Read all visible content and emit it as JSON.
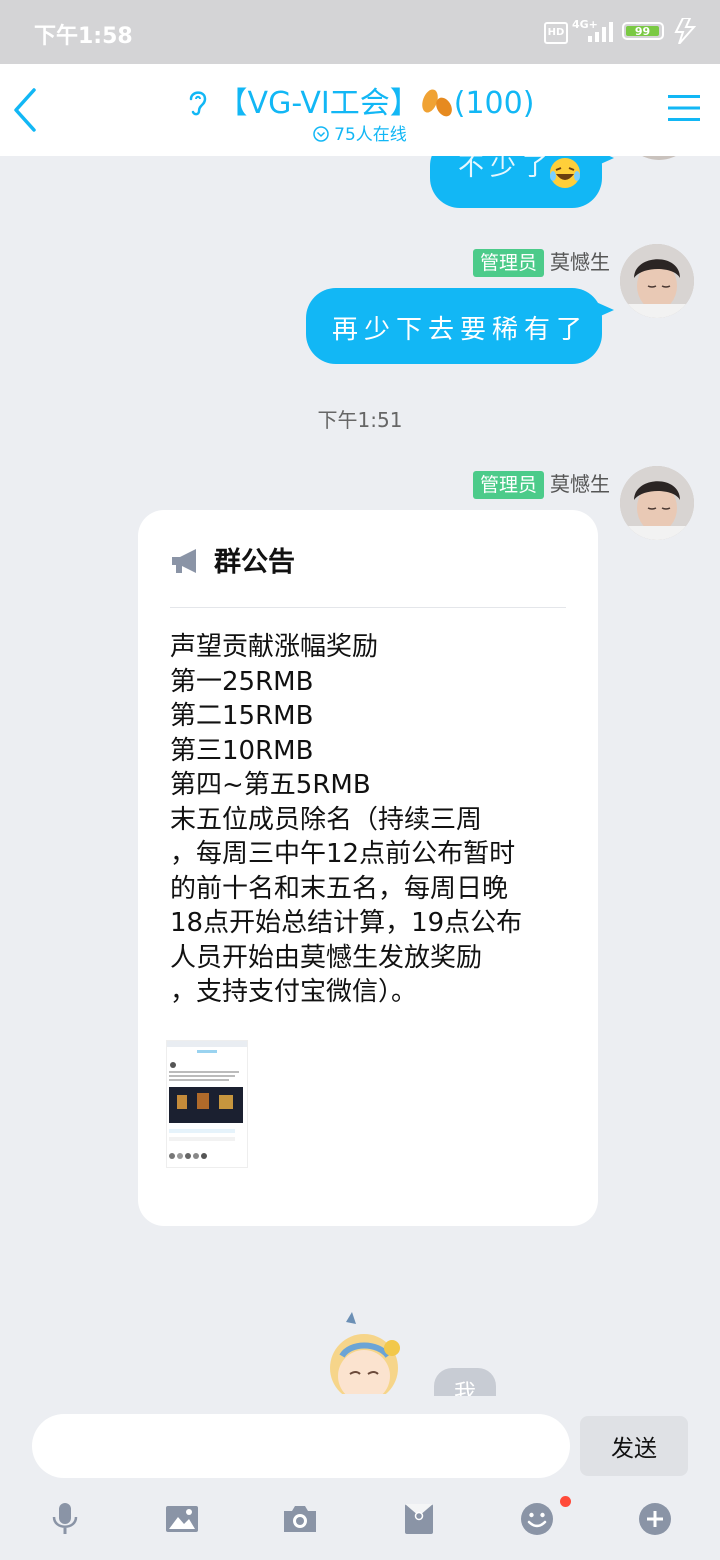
{
  "status_bar": {
    "time": "下午1:58",
    "hd": "HD",
    "network": "4G+",
    "battery": "99"
  },
  "header": {
    "title": "【VG-VI工会】",
    "member_count": "(100)",
    "online": "75人在线",
    "accent_color": "#12b7f5"
  },
  "messages": {
    "partial_top": {
      "text": "不少了"
    },
    "msg2": {
      "role_badge": "管理员",
      "sender": "莫憾生",
      "text": "再少下去要稀有了"
    },
    "timestamp": "下午1:51",
    "msg3": {
      "role_badge": "管理员",
      "sender": "莫憾生",
      "notice_title": "群公告",
      "notice_body": "声望贡献涨幅奖励\n第一25RMB\n第二15RMB\n第三10RMB\n第四~第五5RMB\n末五位成员除名（持续三周\n，每周三中午12点前公布暂时\n的前十名和末五名，每周日晚\n18点开始总结计算，19点公布\n人员开始由莫憾生发放奖励\n，支持支付宝微信）。"
    },
    "me_label": "我"
  },
  "input": {
    "placeholder": "",
    "send_label": "发送"
  },
  "toolbar": [
    "mic-icon",
    "image-icon",
    "camera-icon",
    "red-packet-icon",
    "emoji-icon",
    "plus-icon"
  ]
}
